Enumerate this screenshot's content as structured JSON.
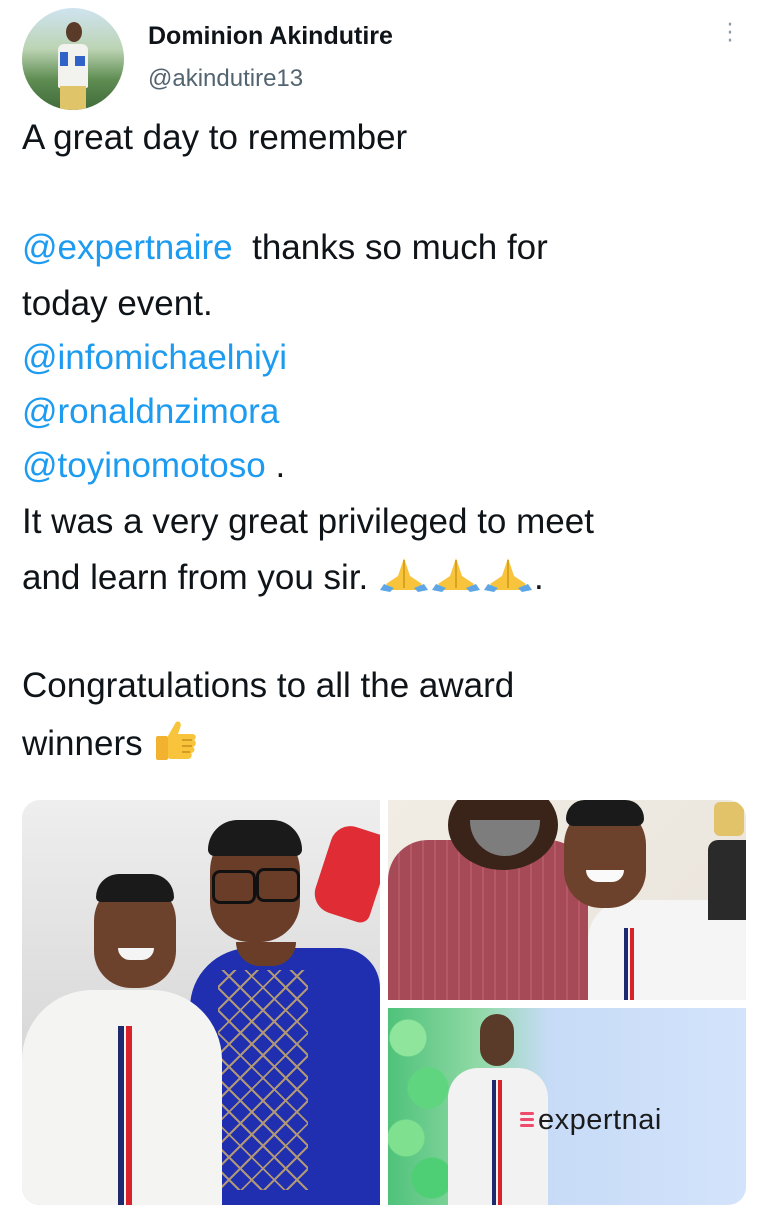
{
  "author": {
    "name": "Dominion Akindutire",
    "handle": "@akindutire13"
  },
  "tweet": {
    "line1": "A great day to remember",
    "mention_expertnaire": "@expertnaire",
    "line2_rest": "thanks so much for",
    "line3": "today event.",
    "mention_infomichaelniyi": "@infomichaelniyi",
    "mention_ronaldnzimora": "@ronaldnzimora",
    "mention_toyinomotoso": "@toyinomotoso",
    "toyin_suffix": ".",
    "line7": "It was a very great privileged to meet",
    "line8": "and learn from you sir.",
    "line8_suffix": ".",
    "line9": "Congratulations to all the award",
    "line10": "winners"
  },
  "media": {
    "banner_text": "expertnai"
  },
  "icons": {
    "more": "more-vertical-icon",
    "pray": "folded-hands-icon",
    "thumbs": "thumbs-up-icon"
  },
  "colors": {
    "link": "#1d9bf0",
    "text": "#0f1419",
    "secondary": "#536471"
  }
}
